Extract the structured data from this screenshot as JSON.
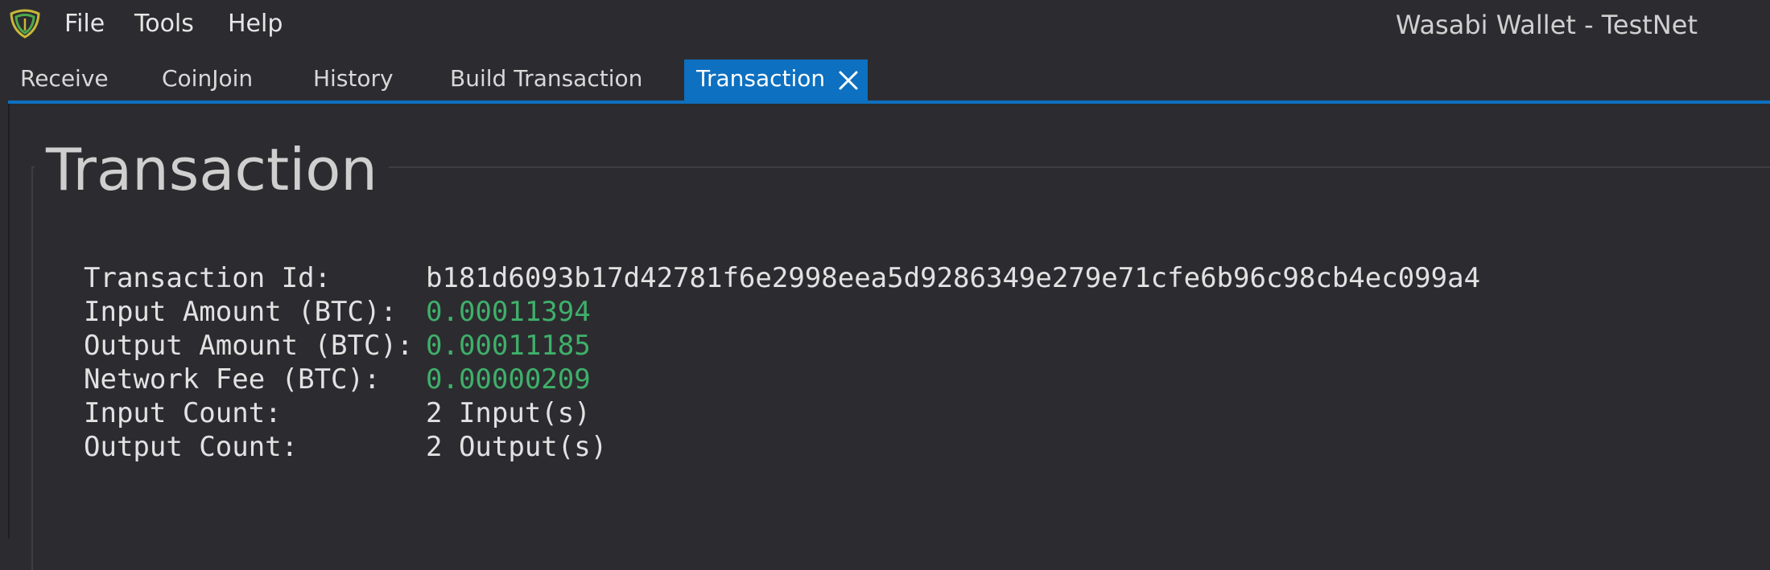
{
  "menu": {
    "file": "File",
    "tools": "Tools",
    "help": "Help"
  },
  "window_title": "Wasabi Wallet - TestNet",
  "tabs": [
    {
      "label": "Receive"
    },
    {
      "label": "CoinJoin"
    },
    {
      "label": "History"
    },
    {
      "label": "Build Transaction"
    },
    {
      "label": "Transaction",
      "active": true
    }
  ],
  "page": {
    "title": "Transaction"
  },
  "details": {
    "transaction_id": {
      "label": "Transaction Id:",
      "value": "b181d6093b17d42781f6e2998eea5d9286349e279e71cfe6b96c98cb4ec099a4"
    },
    "input_amount": {
      "label": "Input Amount (BTC):",
      "value": "0.00011394"
    },
    "output_amount": {
      "label": "Output Amount (BTC):",
      "value": "0.00011185"
    },
    "network_fee": {
      "label": "Network Fee (BTC):",
      "value": "0.00000209"
    },
    "input_count": {
      "label": "Input Count:",
      "value": "2 Input(s)"
    },
    "output_count": {
      "label": "Output Count:",
      "value": "2 Output(s)"
    }
  },
  "colors": {
    "accent": "#0e70c0",
    "amount_green": "#3fb06a",
    "background": "#2c2c30",
    "logo_yellow": "#c8b83a",
    "logo_green": "#4caa4a"
  },
  "icons": {
    "logo": "wasabi-shield-logo-icon",
    "tab_close": "close-icon"
  }
}
